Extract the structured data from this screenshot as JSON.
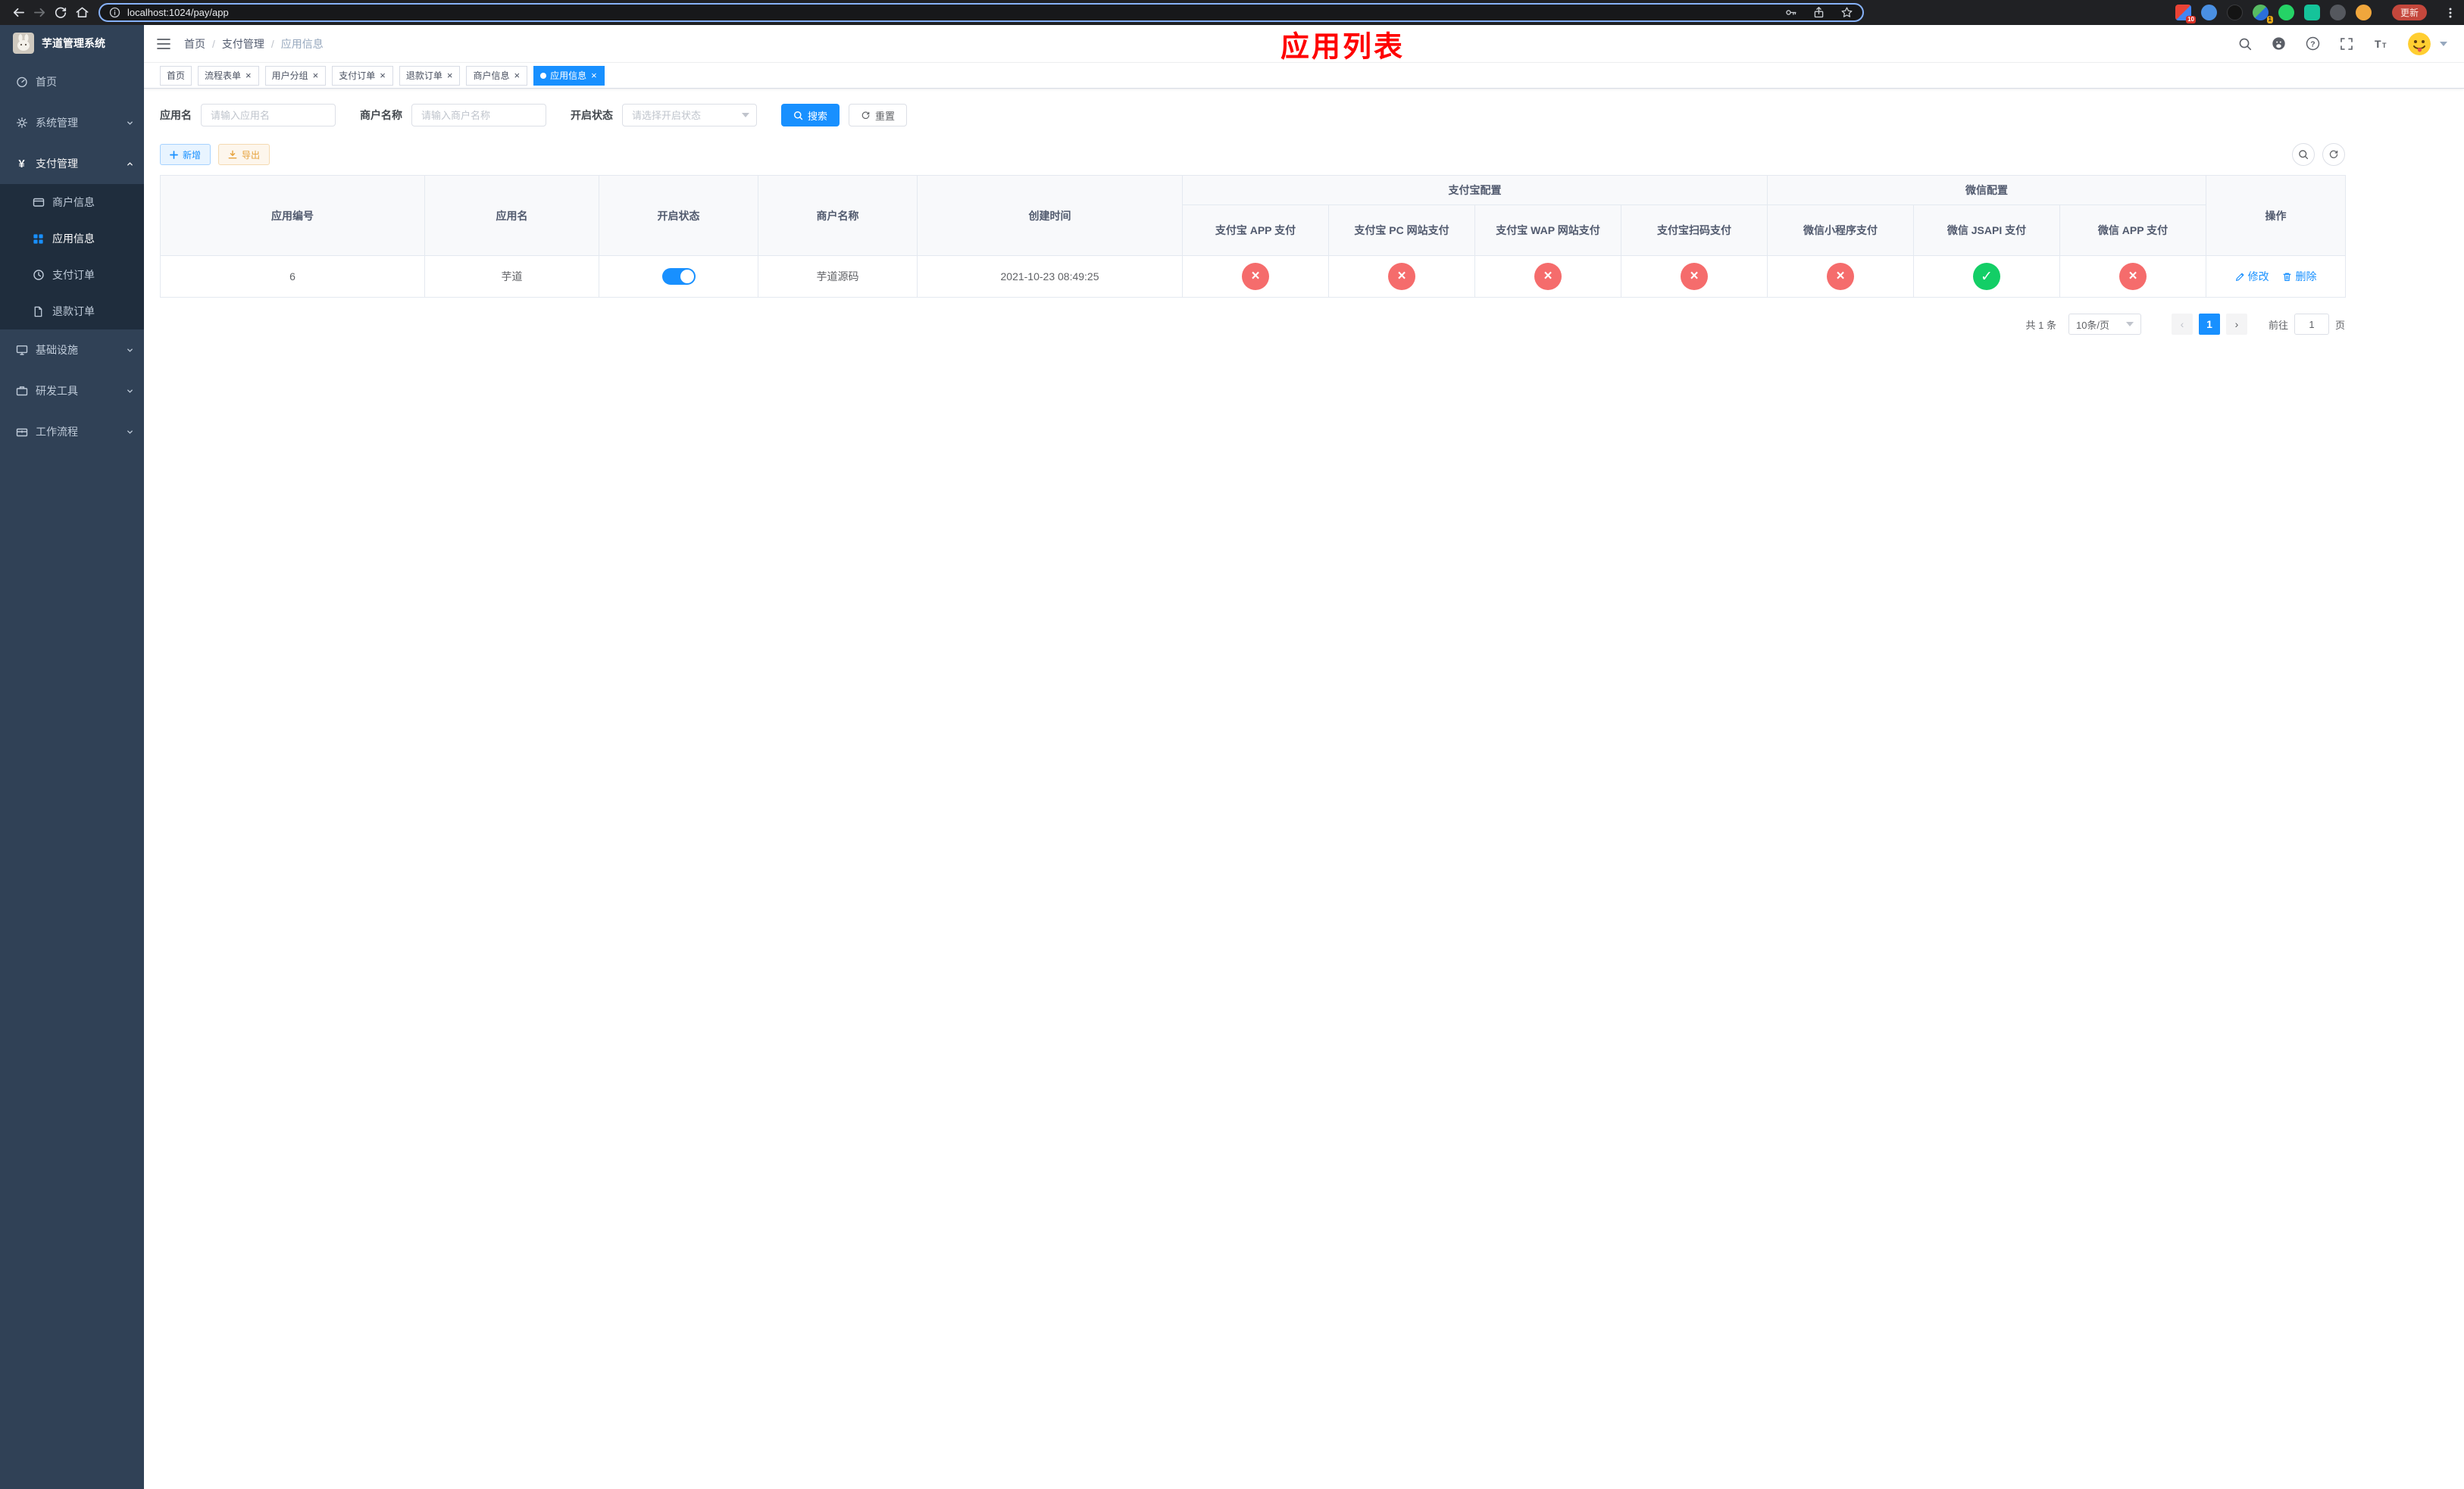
{
  "theme": {
    "accent": "#1890ff",
    "danger": "#f56c6c",
    "success": "#13ce66",
    "warning": "#e6a23c",
    "sidebar_bg": "#304156",
    "submenu_bg": "#1f2d3d",
    "annotation_red": "#ff0000"
  },
  "browser": {
    "url": "localhost:1024/pay/app",
    "update_label": "更新",
    "extension_badges": {
      "first": "10",
      "fourth": "1"
    }
  },
  "sidebar": {
    "title": "芋道管理系统",
    "items": [
      {
        "label": "首页",
        "icon": "dashboard-icon"
      },
      {
        "label": "系统管理",
        "icon": "gear-icon"
      },
      {
        "label": "支付管理",
        "icon": "yuan-icon"
      },
      {
        "label": "商户信息",
        "icon": "merchant-card-icon"
      },
      {
        "label": "应用信息",
        "icon": "app-grid-icon"
      },
      {
        "label": "支付订单",
        "icon": "order-clock-icon"
      },
      {
        "label": "退款订单",
        "icon": "refund-doc-icon"
      },
      {
        "label": "基础设施",
        "icon": "infra-monitor-icon"
      },
      {
        "label": "研发工具",
        "icon": "dev-tools-icon"
      },
      {
        "label": "工作流程",
        "icon": "workflow-icon"
      }
    ]
  },
  "navbar": {
    "breadcrumb": [
      "首页",
      "支付管理",
      "应用信息"
    ],
    "annotation": "应用列表"
  },
  "tags": [
    {
      "label": "首页"
    },
    {
      "label": "流程表单"
    },
    {
      "label": "用户分组"
    },
    {
      "label": "支付订单"
    },
    {
      "label": "退款订单"
    },
    {
      "label": "商户信息"
    },
    {
      "label": "应用信息"
    }
  ],
  "filter": {
    "app_name_label": "应用名",
    "app_name_placeholder": "请输入应用名",
    "merchant_label": "商户名称",
    "merchant_placeholder": "请输入商户名称",
    "status_label": "开启状态",
    "status_placeholder": "请选择开启状态",
    "search_label": "搜索",
    "reset_label": "重置"
  },
  "toolbar": {
    "add_label": "新增",
    "export_label": "导出"
  },
  "table": {
    "group_alipay": "支付宝配置",
    "group_wechat": "微信配置",
    "col_id": "应用编号",
    "col_name": "应用名",
    "col_status": "开启状态",
    "col_merchant": "商户名称",
    "col_created": "创建时间",
    "col_alipay_app": "支付宝 APP 支付",
    "col_alipay_pc": "支付宝 PC 网站支付",
    "col_alipay_wap": "支付宝 WAP 网站支付",
    "col_alipay_qr": "支付宝扫码支付",
    "col_wx_lite": "微信小程序支付",
    "col_wx_jsapi": "微信 JSAPI 支付",
    "col_wx_app": "微信 APP 支付",
    "col_actions": "操作",
    "rows": [
      {
        "id": "6",
        "name": "芋道",
        "enabled": true,
        "merchant": "芋道源码",
        "created": "2021-10-23 08:49:25",
        "configs": {
          "alipay_app": false,
          "alipay_pc": false,
          "alipay_wap": false,
          "alipay_qr": false,
          "wx_lite": false,
          "wx_jsapi": true,
          "wx_app": false
        },
        "edit_label": "修改",
        "delete_label": "删除"
      }
    ]
  },
  "pagination": {
    "total": "共 1 条",
    "page_size": "10条/页",
    "current_page": "1",
    "goto_label": "前往",
    "goto_value": "1",
    "page_unit": "页"
  }
}
